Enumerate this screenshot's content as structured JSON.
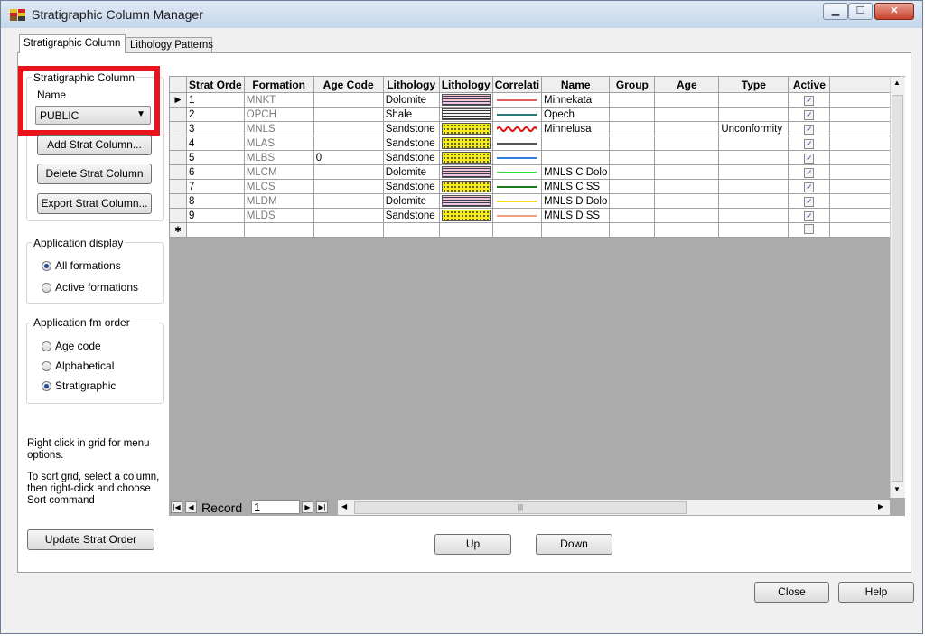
{
  "window": {
    "title": "Stratigraphic Column Manager"
  },
  "tabs": [
    "Stratigraphic Column",
    "Lithology Patterns"
  ],
  "strat_group": {
    "legend": "Stratigraphic Column",
    "name_label": "Name",
    "name_value": "PUBLIC"
  },
  "buttons": {
    "add": "Add Strat Column...",
    "delete": "Delete Strat Column",
    "export": "Export Strat Column...",
    "update": "Update Strat Order",
    "up": "Up",
    "down": "Down",
    "close": "Close",
    "help": "Help"
  },
  "app_display": {
    "legend": "Application display",
    "options": [
      "All formations",
      "Active formations"
    ],
    "selected": 0
  },
  "app_order": {
    "legend": "Application fm order",
    "options": [
      "Age code",
      "Alphabetical",
      "Stratigraphic"
    ],
    "selected": 2
  },
  "notes": {
    "right_click": "Right click in grid for menu options.",
    "sort": "To sort grid, select a column, then right-click and choose Sort command"
  },
  "grid": {
    "columns": [
      "Strat Orde",
      "Formation",
      "Age Code",
      "Lithology",
      "Lithology",
      "Correlati",
      "Name",
      "Group",
      "Age",
      "Type",
      "Active"
    ],
    "rows": [
      {
        "order": "1",
        "formation": "MNKT",
        "age_code": "",
        "lithology": "Dolomite",
        "pattern": "dolomite",
        "corr_color": "#e06060",
        "corr_style": "solid",
        "name": "Minnekata",
        "group": "",
        "age": "",
        "type": "",
        "active": true
      },
      {
        "order": "2",
        "formation": "OPCH",
        "age_code": "",
        "lithology": "Shale",
        "pattern": "shale",
        "corr_color": "#2a7a7a",
        "corr_style": "solid",
        "name": "Opech",
        "group": "",
        "age": "",
        "type": "",
        "active": true
      },
      {
        "order": "3",
        "formation": "MNLS",
        "age_code": "",
        "lithology": "Sandstone",
        "pattern": "sandstone",
        "corr_color": "#e01010",
        "corr_style": "wavy",
        "name": "Minnelusa",
        "group": "",
        "age": "",
        "type": "Unconformity",
        "active": true
      },
      {
        "order": "4",
        "formation": "MLAS",
        "age_code": "",
        "lithology": "Sandstone",
        "pattern": "sandstone",
        "corr_color": "#555555",
        "corr_style": "solid",
        "name": "",
        "group": "",
        "age": "",
        "type": "",
        "active": true
      },
      {
        "order": "5",
        "formation": "MLBS",
        "age_code": "0",
        "lithology": "Sandstone",
        "pattern": "sandstone",
        "corr_color": "#2f7fe0",
        "corr_style": "solid",
        "name": "",
        "group": "",
        "age": "",
        "type": "",
        "active": true
      },
      {
        "order": "6",
        "formation": "MLCM",
        "age_code": "",
        "lithology": "Dolomite",
        "pattern": "dolomite",
        "corr_color": "#30e030",
        "corr_style": "solid",
        "name": "MNLS C Dolo",
        "group": "",
        "age": "",
        "type": "",
        "active": true
      },
      {
        "order": "7",
        "formation": "MLCS",
        "age_code": "",
        "lithology": "Sandstone",
        "pattern": "sandstone",
        "corr_color": "#1a7a1a",
        "corr_style": "solid",
        "name": "MNLS C SS",
        "group": "",
        "age": "",
        "type": "",
        "active": true
      },
      {
        "order": "8",
        "formation": "MLDM",
        "age_code": "",
        "lithology": "Dolomite",
        "pattern": "dolomite",
        "corr_color": "#f2e21a",
        "corr_style": "solid",
        "name": "MNLS D Dolo",
        "group": "",
        "age": "",
        "type": "",
        "active": true
      },
      {
        "order": "9",
        "formation": "MLDS",
        "age_code": "",
        "lithology": "Sandstone",
        "pattern": "sandstone",
        "corr_color": "#f0a080",
        "corr_style": "solid",
        "name": "MNLS D SS",
        "group": "",
        "age": "",
        "type": "",
        "active": true
      }
    ]
  },
  "navigator": {
    "label": "Record",
    "value": "1"
  }
}
